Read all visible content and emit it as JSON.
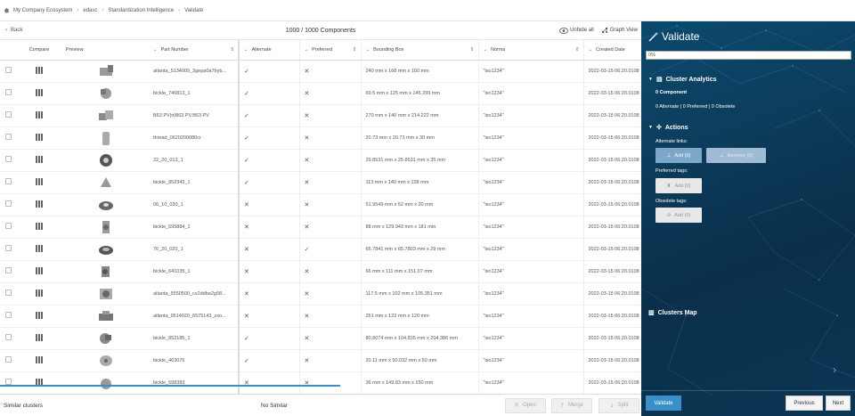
{
  "breadcrumb": [
    "My Company Ecosystem",
    "edasc",
    "Standardization Intelligence",
    "Validate"
  ],
  "toolbar": {
    "back_label": "Back",
    "count_title": "1000 / 1000 Components",
    "unhide_label": "Unhide all",
    "graph_label": "Graph View"
  },
  "columns": {
    "compare": "Compare",
    "preview": "Preview",
    "part": "Part Number",
    "alternate": "Alternate",
    "preferred": "Preferred",
    "box": "Bounding Box",
    "norms": "Norms",
    "date": "Created Date"
  },
  "rows": [
    {
      "part": "atlanta_5134009_3gepa0a7byb...",
      "alt": "✓",
      "pref": "✕",
      "box": "240 mm x 168 mm x 160 mm",
      "norms": "\"iso1234\"",
      "date": "2022-03-15 06:20.0108"
    },
    {
      "part": "bickle_740813_1",
      "alt": "✓",
      "pref": "✕",
      "box": "69.5 mm x 125 mm x 145.299 mm",
      "norms": "\"iso1234\"",
      "date": "2022-03-15 06:20.0108"
    },
    {
      "part": "B63 PV|¤|B63 PV.B63 PV",
      "alt": "✓",
      "pref": "✕",
      "box": "270 mm x 140 mm x 214.222 mm",
      "norms": "\"iso1234\"",
      "date": "2022-03-15 06:20.0108"
    },
    {
      "part": "thread_0620200080cr",
      "alt": "✓",
      "pref": "✕",
      "box": "20.73 mm x 20.73 mm x 30 mm",
      "norms": "\"iso1234\"",
      "date": "2022-03-15 06:20.0108"
    },
    {
      "part": "22_20_013_1",
      "alt": "✓",
      "pref": "✕",
      "box": "29.8531 mm x 25.8531 mm x 35 mm",
      "norms": "\"iso1234\"",
      "date": "2022-03-15 06:20.0108"
    },
    {
      "part": "bickle_852342_1",
      "alt": "✓",
      "pref": "✕",
      "box": "113 mm x 140 mm x 138 mm",
      "norms": "\"iso1234\"",
      "date": "2022-03-15 06:20.0108"
    },
    {
      "part": "06_10_030_1",
      "alt": "✕",
      "pref": "✕",
      "box": "51.9549 mm x 52 mm x 20 mm",
      "norms": "\"iso1234\"",
      "date": "2022-03-15 06:20.0108"
    },
    {
      "part": "bickle_595884_1",
      "alt": "✕",
      "pref": "✕",
      "box": "88 mm x 129.943 mm x 181 mm",
      "norms": "\"iso1234\"",
      "date": "2022-03-15 06:20.0108"
    },
    {
      "part": "76_20_020_1",
      "alt": "✕",
      "pref": "✓",
      "box": "65.7841 mm x 65.7803 mm x 29 mm",
      "norms": "\"iso1234\"",
      "date": "2022-03-15 06:20.0108"
    },
    {
      "part": "bickle_641035_1",
      "alt": "✕",
      "pref": "✕",
      "box": "66 mm x 111 mm x 151.07 mm",
      "norms": "\"iso1234\"",
      "date": "2022-03-15 06:20.0108"
    },
    {
      "part": "atlanta_5550500_cv2ddba2g58...",
      "alt": "✕",
      "pref": "✕",
      "box": "117.5 mm x 102 mm x 105.351 mm",
      "norms": "\"iso1234\"",
      "date": "2022-03-15 06:20.0108"
    },
    {
      "part": "atlanta_9514020_6575143_zxo...",
      "alt": "✕",
      "pref": "✕",
      "box": "251 mm x 122 mm x 120 mm",
      "norms": "\"iso1234\"",
      "date": "2022-03-15 06:20.0108"
    },
    {
      "part": "bickle_852185_1",
      "alt": "✓",
      "pref": "✕",
      "box": "80.8074 mm x 104.835 mm x 204.386 mm",
      "norms": "\"iso1234\"",
      "date": "2022-03-15 06:20.0108"
    },
    {
      "part": "bickle_463076",
      "alt": "✓",
      "pref": "✕",
      "box": "20.11 mm x 50.032 mm x 50 mm",
      "norms": "\"iso1234\"",
      "date": "2022-03-15 06:20.0108"
    },
    {
      "part": "bickle_598383",
      "alt": "✕",
      "pref": "✕",
      "box": "36 mm x 149.83 mm x 150 mm",
      "norms": "\"iso1234\"",
      "date": "2022-03-15 06:20.0108"
    }
  ],
  "bottom": {
    "similar_label": "Similar clusters",
    "no_similar": "No Similar",
    "open": "Open",
    "merge": "Merge",
    "split": "Split"
  },
  "panel": {
    "title": "Validate",
    "progress": "0%",
    "cluster_analytics": "Cluster Analytics",
    "component_count": "0 Component",
    "summary": "0 Alternate | 0 Preferred | 0 Obsolete",
    "actions": "Actions",
    "alt_links": "Alternate links:",
    "add": "Add (0)",
    "remove": "Remove (0)",
    "pref_tags": "Preferred tags:",
    "obs_tags": "Obsolete tags:",
    "clusters_map": "Clusters Map",
    "validate": "Validate",
    "previous": "Previous",
    "next": "Next"
  },
  "colors": {
    "accent": "#3a8fc8",
    "panel_bg": "#0c3d5c"
  }
}
